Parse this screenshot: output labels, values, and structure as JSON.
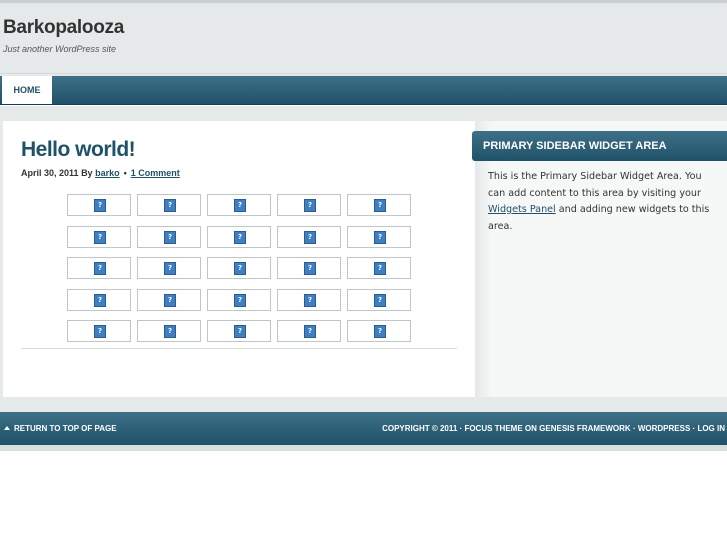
{
  "header": {
    "site_title": "Barkopalooza",
    "site_description": "Just another WordPress site"
  },
  "nav": {
    "items": [
      {
        "label": "HOME"
      }
    ]
  },
  "post": {
    "title": "Hello world!",
    "date": "April 30, 2011",
    "by_label": "By",
    "author": "barko",
    "separator": "•",
    "comments": "1 Comment",
    "gallery": {
      "rows": 5,
      "columns": 5,
      "placeholder_icon": "broken-image-icon",
      "placeholder_glyph": "?"
    }
  },
  "sidebar": {
    "widget_title": "PRIMARY SIDEBAR WIDGET AREA",
    "text_before": "This is the Primary Sidebar Widget Area. You can add content to this area by visiting your ",
    "link_text": "Widgets Panel",
    "text_after": " and adding new widgets to this area."
  },
  "footer": {
    "back_to_top": "RETURN TO TOP OF PAGE",
    "copyright": "COPYRIGHT © 2011 ·",
    "theme_link": "FOCUS THEME",
    "on_label": "ON",
    "framework_link": "GENESIS FRAMEWORK",
    "sep1": "·",
    "wordpress_link": "WORDPRESS",
    "sep2": "·",
    "login_link": "LOG IN"
  },
  "colors": {
    "accent": "#1f5168",
    "header_bg": "#e6e9ea",
    "placeholder_icon": "#3d7fc1"
  }
}
